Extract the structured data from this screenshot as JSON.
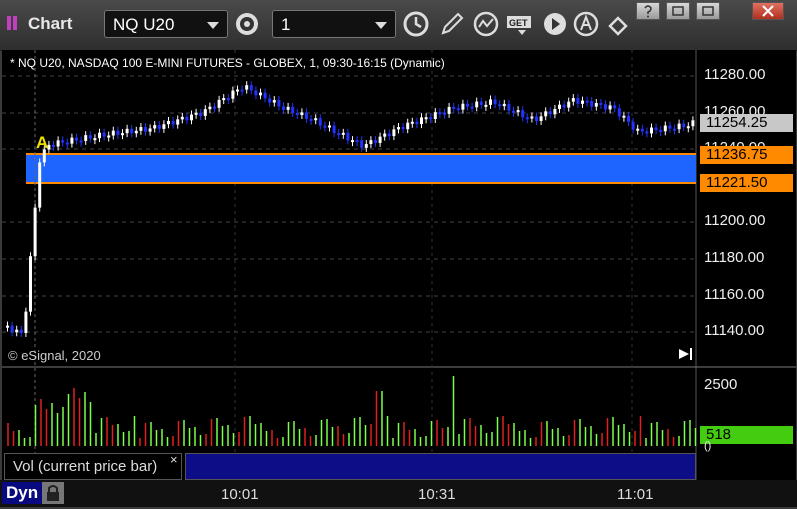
{
  "app": {
    "title": "Chart"
  },
  "toolbar": {
    "symbol_value": "NQ U20",
    "interval_value": "1",
    "icons": [
      "settings-gear-icon",
      "clock-icon",
      "pencil-icon",
      "study-icon",
      "get-icon",
      "play-icon",
      "alert-a-icon",
      "link-icon"
    ],
    "get_label": "GET"
  },
  "chart": {
    "header": "* NQ U20, NASDAQ 100 E-MINI FUTURES - GLOBEX, 1, 09:30-16:15 (Dynamic)",
    "copyright": "© eSignal, 2020",
    "marker": "A",
    "price_labels": [
      "11280.00",
      "11260.00",
      "11240.00",
      "11200.00",
      "11180.00",
      "11160.00",
      "11140.00"
    ],
    "last_price": "11254.25",
    "zone_top": "11236.75",
    "zone_bottom": "11221.50",
    "colors": {
      "zone": "#1e64ff",
      "zone_line": "#ff8a00",
      "up": "#ffffff",
      "down": "#2233ff",
      "last": "#c8c8c8",
      "vol_up": "#7cff4a",
      "vol_down": "#e02020"
    }
  },
  "volume": {
    "axis_label": "2500",
    "current_value": "518",
    "legend": "Vol (current price bar)",
    "close_symbol": "×",
    "sub_label": "()"
  },
  "footer": {
    "mode": "Dyn",
    "times": [
      "10:01",
      "10:31",
      "11:01"
    ]
  }
}
